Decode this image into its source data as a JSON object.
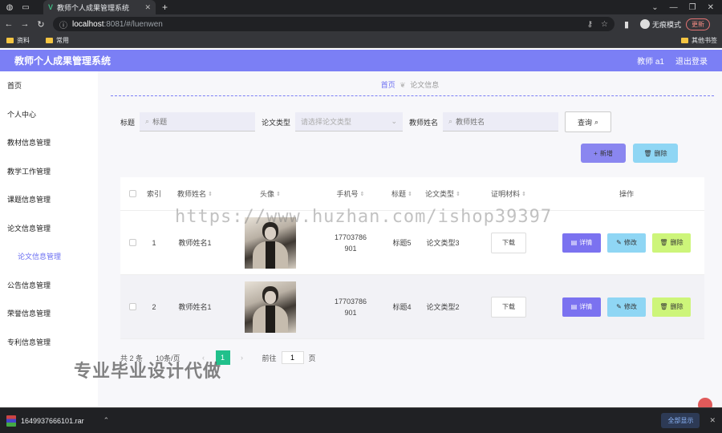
{
  "browser": {
    "tab_title": "教师个人成果管理系统",
    "url_host": "localhost",
    "url_rest": ":8081/#/luenwen",
    "profile_label": "无痕模式",
    "update_label": "更新",
    "bookmarks": [
      "资料",
      "常用"
    ],
    "bookmarks_right": "其他书签"
  },
  "header": {
    "title": "教师个人成果管理系统",
    "user": "教师 a1",
    "logout": "退出登录"
  },
  "sidebar": {
    "items": [
      "首页",
      "个人中心",
      "教材信息管理",
      "教学工作管理",
      "课题信息管理",
      "论文信息管理",
      "论文信息管理",
      "公告信息管理",
      "荣誉信息管理",
      "专利信息管理"
    ]
  },
  "breadcrumb": {
    "home": "首页",
    "current": "论文信息"
  },
  "search": {
    "title_label": "标题",
    "title_placeholder": "标题",
    "type_label": "论文类型",
    "type_placeholder": "请选择论文类型",
    "teacher_label": "教师姓名",
    "teacher_placeholder": "教师姓名",
    "query_label": "查询"
  },
  "actions": {
    "add": "新增",
    "delete": "删除"
  },
  "table": {
    "headers": {
      "index": "索引",
      "teacher": "教师姓名",
      "avatar": "头像",
      "phone": "手机号",
      "title": "标题",
      "type": "论文类型",
      "file": "证明材料",
      "ops": "操作"
    },
    "rows": [
      {
        "index": "1",
        "teacher": "教师姓名1",
        "phone1": "17703786",
        "phone2": "901",
        "title": "标题5",
        "type": "论文类型3",
        "download": "下载",
        "detail": "详情",
        "edit": "修改",
        "delete": "删除"
      },
      {
        "index": "2",
        "teacher": "教师姓名1",
        "phone1": "17703786",
        "phone2": "901",
        "title": "标题4",
        "type": "论文类型2",
        "download": "下载",
        "detail": "详情",
        "edit": "修改",
        "delete": "删除"
      }
    ]
  },
  "pager": {
    "total": "共 2 条",
    "page_size": "10条/页",
    "current": "1",
    "goto_label": "前往",
    "goto_value": "1",
    "page_unit": "页"
  },
  "overlays": {
    "watermark": "https://www.huzhan.com/ishop39397",
    "promo": "专业毕业设计代做"
  },
  "download_bar": {
    "file": "1649937666101.rar",
    "show_all": "全部显示"
  }
}
